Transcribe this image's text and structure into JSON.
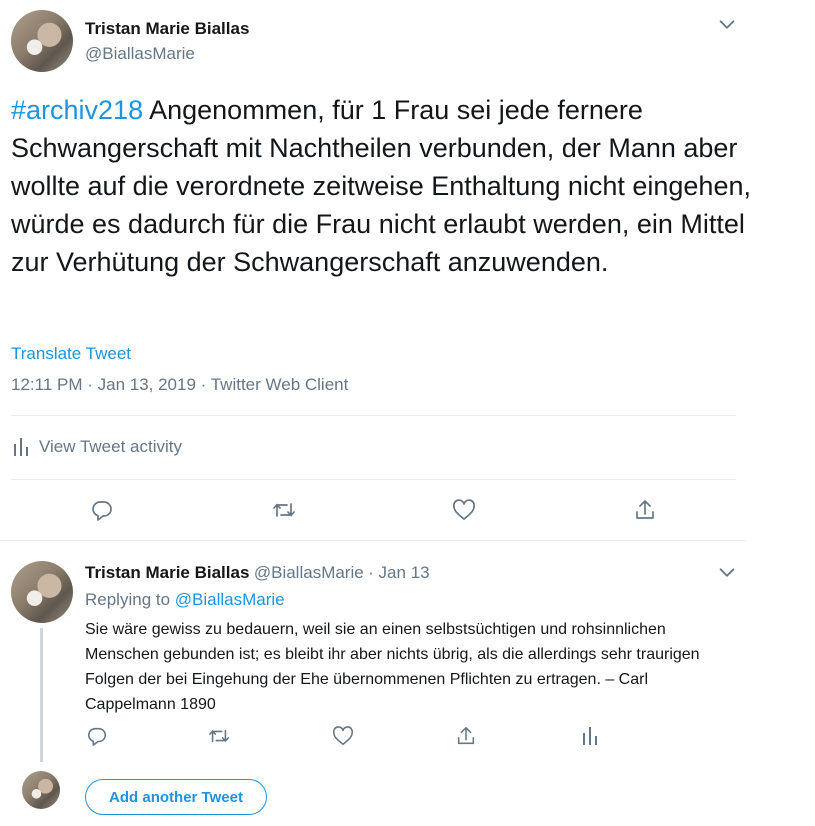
{
  "main_tweet": {
    "author_name": "Tristan Marie Biallas",
    "author_handle": "@BiallasMarie",
    "hashtag": "#archiv218",
    "text": " Angenommen, für 1 Frau sei jede fernere Schwangerschaft mit Nachtheilen verbunden, der Mann aber wollte auf die verordnete zeitweise Enthaltung nicht eingehen, würde es dadurch für die Frau nicht erlaubt werden, ein Mittel zur Verhütung der Schwangerschaft anzuwenden.",
    "translate_label": "Translate Tweet",
    "timestamp": "12:11 PM · Jan 13, 2019 · Twitter Web Client",
    "activity_label": "View Tweet activity",
    "icons": [
      "reply-icon",
      "retweet-icon",
      "like-icon",
      "share-icon"
    ]
  },
  "reply_tweet": {
    "author_name": "Tristan Marie Biallas",
    "author_handle": "@BiallasMarie",
    "date": "· Jan 13",
    "replying_prefix": "Replying to",
    "replying_handle": "@BiallasMarie",
    "text": "Sie wäre gewiss zu bedauern, weil sie an einen selbstsüchtigen  und rohsinnlichen Menschen gebunden ist; es bleibt ihr aber nichts übrig, als die allerdings sehr traurigen Folgen der bei Eingehung der  Ehe übernommenen Pflichten zu ertragen. –  Carl  Cappelmann 1890",
    "icons": [
      "reply-icon",
      "retweet-icon",
      "like-icon",
      "share-icon",
      "analytics-icon"
    ]
  },
  "add_another_tweet_label": "Add another Tweet",
  "colors": {
    "accent": "#1b95e0",
    "muted": "#657786",
    "text": "#14171a",
    "divider": "#e6ecf0"
  }
}
